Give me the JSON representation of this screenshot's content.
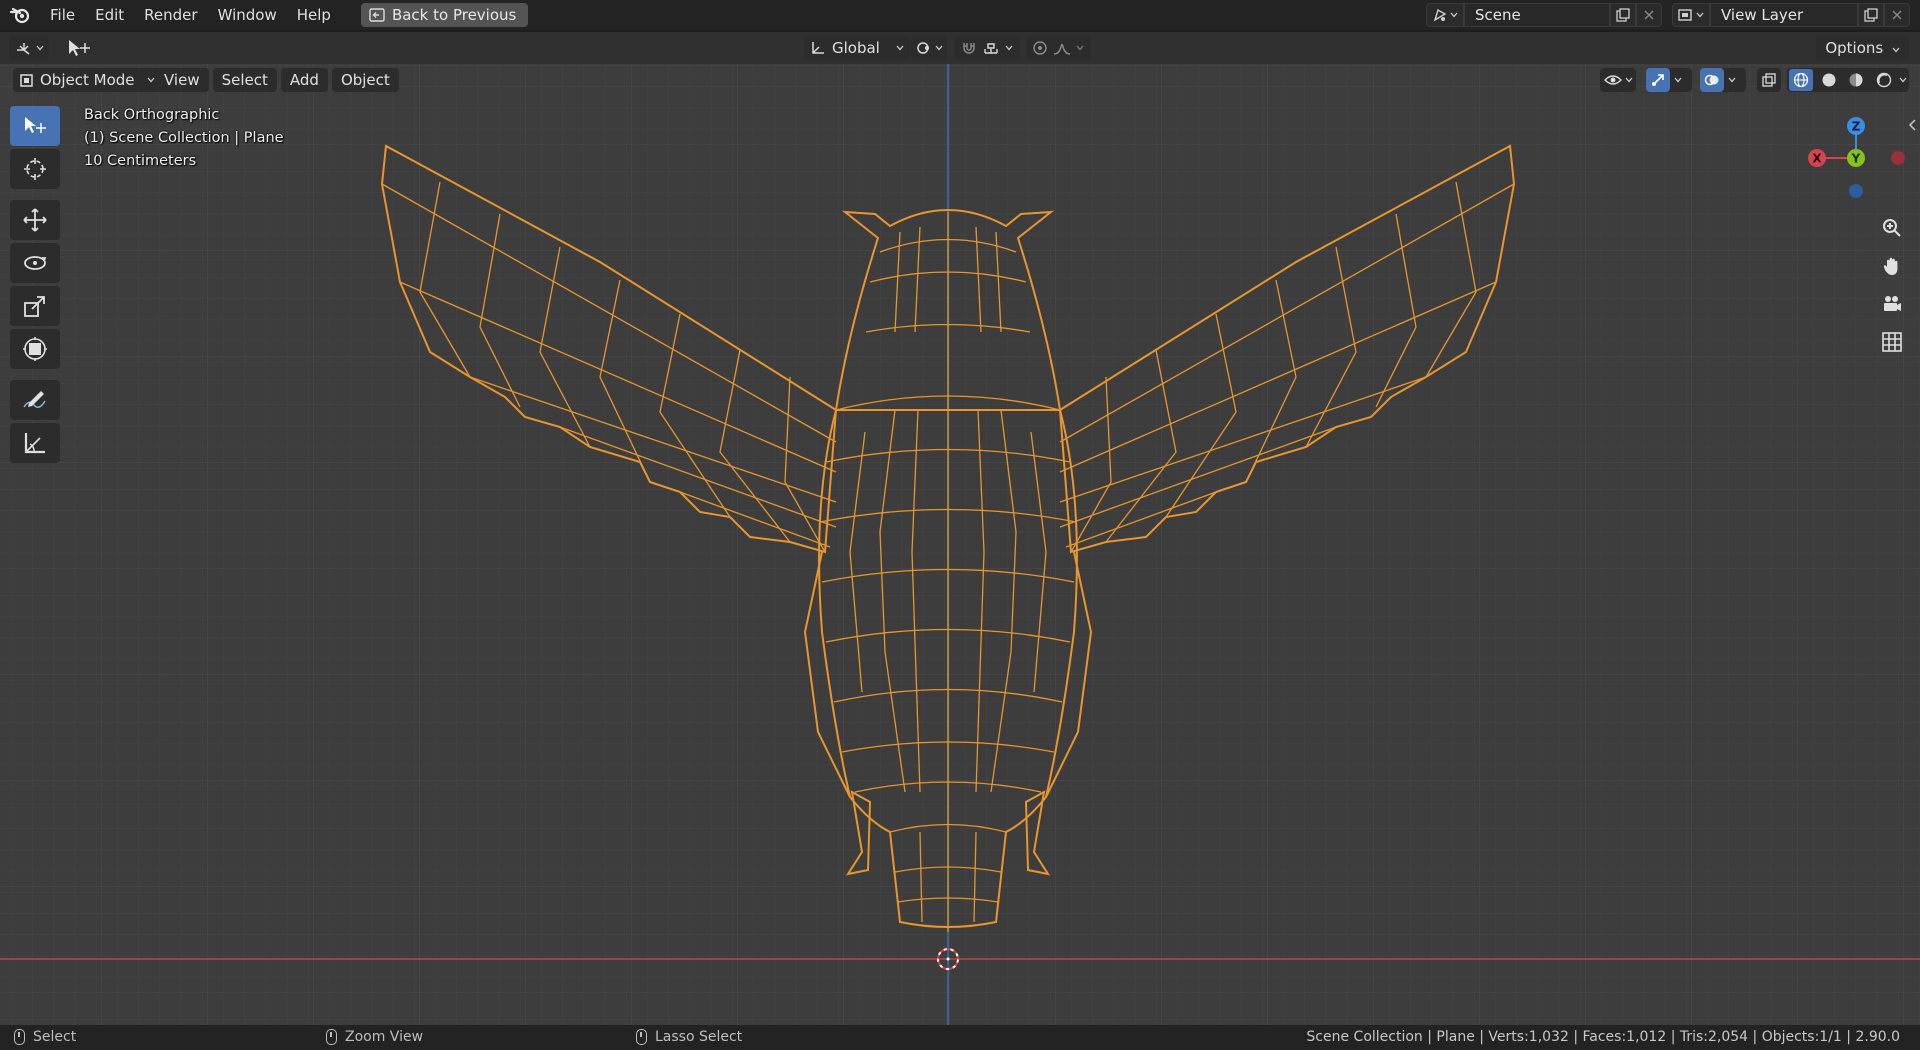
{
  "menu": [
    "File",
    "Edit",
    "Render",
    "Window",
    "Help"
  ],
  "back_button": "Back to Previous",
  "scene": {
    "name": "Scene"
  },
  "view_layer": {
    "name": "View Layer"
  },
  "header": {
    "orientation": "Global",
    "options": "Options",
    "mode": "Object Mode",
    "menus": [
      "View",
      "Select",
      "Add",
      "Object"
    ]
  },
  "viewport_info": {
    "view_name": "Back Orthographic",
    "collection": "(1) Scene Collection | Plane",
    "scale": "10 Centimeters"
  },
  "gizmo": {
    "z": "Z",
    "x": "X",
    "y": "Y"
  },
  "status": {
    "left_click": "Select",
    "middle_click": "Zoom View",
    "right_click": "Lasso Select",
    "stats": "Scene Collection | Plane | Verts:1,032 | Faces:1,012 | Tris:2,054 | Objects:1/1 | 2.90.0"
  },
  "colors": {
    "wire": "#e8962e",
    "viewport_bg": "#3d3d3d",
    "active_tool": "#4772b3",
    "x_axis": "#d6454d",
    "y_axis": "#85c21a",
    "z_axis": "#3a8ce8"
  },
  "icons": {
    "blender_logo": "blender-logo-icon",
    "tools": [
      "select-box-icon",
      "cursor-icon",
      "move-icon",
      "rotate-icon",
      "scale-icon",
      "transform-icon",
      "annotate-icon",
      "measure-icon"
    ],
    "navigation": [
      "zoom-icon",
      "pan-hand-icon",
      "camera-icon",
      "grid-icon"
    ]
  }
}
